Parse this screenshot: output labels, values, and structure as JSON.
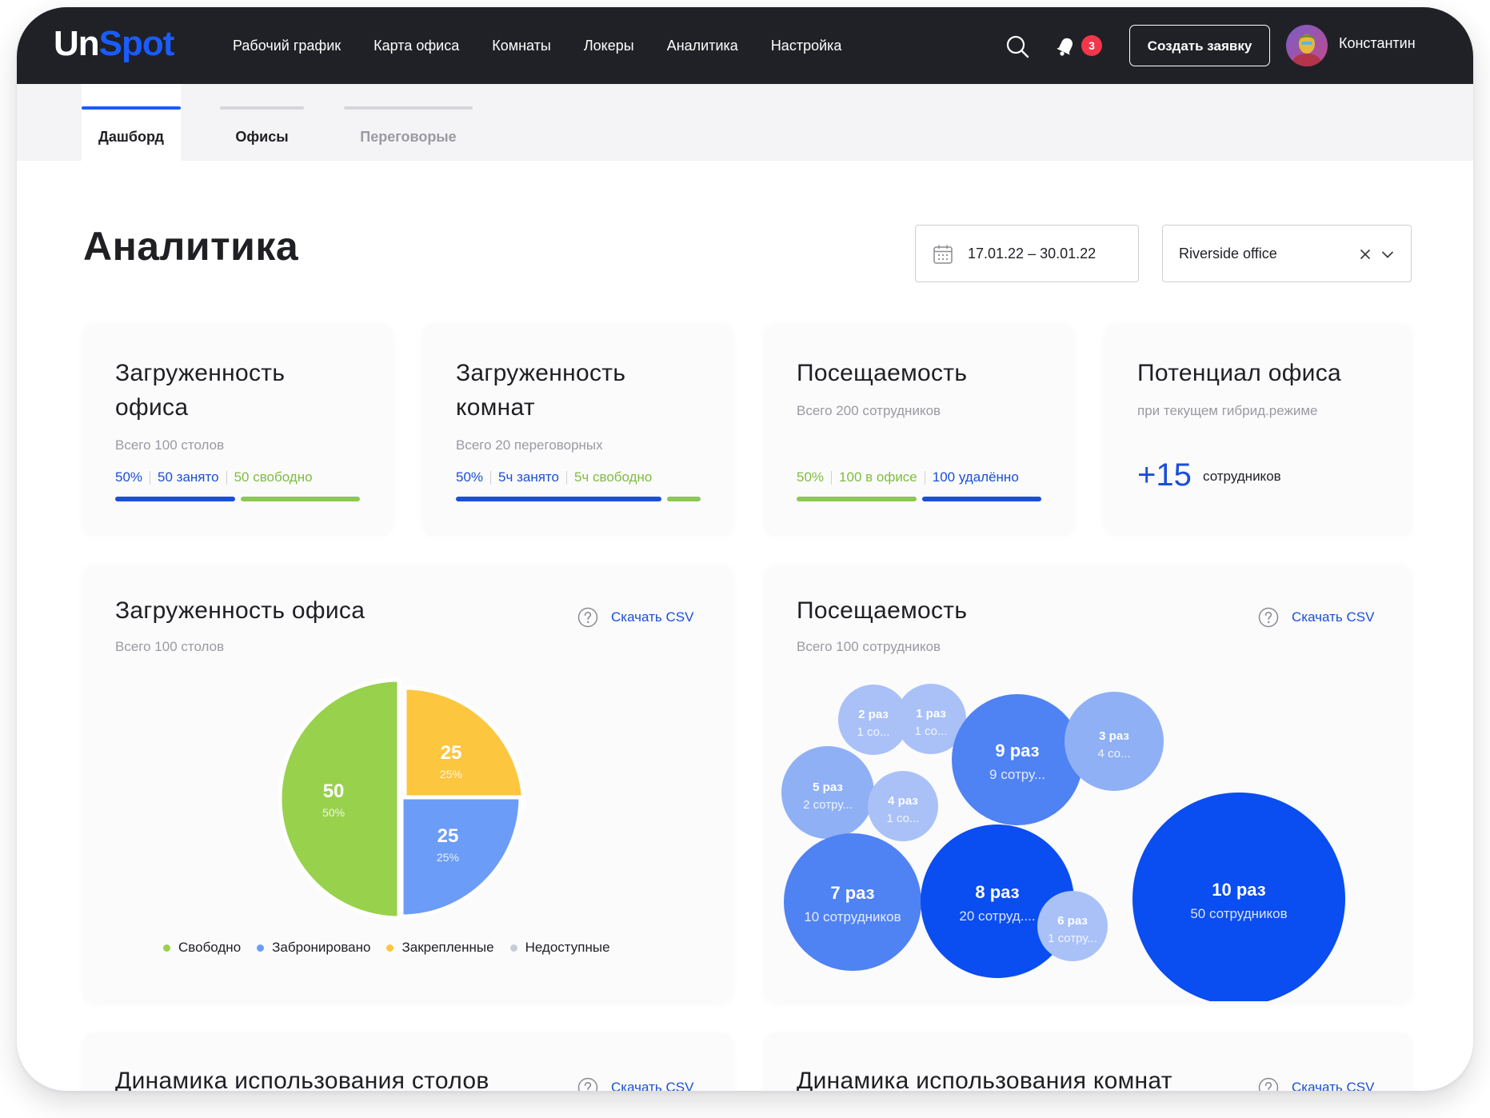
{
  "brand": {
    "logo_part1": "Un",
    "logo_part2": "Spot"
  },
  "nav": {
    "items": [
      "Рабочий график",
      "Карта офиса",
      "Комнаты",
      "Локеры",
      "Аналитика",
      "Настройка"
    ],
    "notifications_count": "3",
    "create_button": "Создать заявку",
    "user_name": "Константин"
  },
  "tabs": [
    {
      "label": "Дашборд",
      "active": true
    },
    {
      "label": "Офисы",
      "active": false
    },
    {
      "label": "Переговорые",
      "active": false
    }
  ],
  "page": {
    "title": "Аналитика",
    "date_range": "17.01.22 – 30.01.22",
    "office": "Riverside office"
  },
  "kpis": {
    "office_load": {
      "title_line1": "Загруженность",
      "title_line2": "офиса",
      "subtitle": "Всего 100 столов",
      "percent": "50%",
      "busy": "50 занято",
      "free": "50 свободно",
      "busy_fraction": 0.5
    },
    "rooms_load": {
      "title_line1": "Загруженность",
      "title_line2": "комнат",
      "subtitle": "Всего 20 переговорных",
      "percent": "50%",
      "busy": "5ч занято",
      "free": "5ч свободно",
      "busy_fraction": 0.86
    },
    "attendance": {
      "title": "Посещаемость",
      "subtitle": "Всего 200 сотрудников",
      "percent": "50%",
      "in_office": "100 в офисе",
      "remote": "100 удалённо",
      "office_fraction": 0.5
    },
    "potential": {
      "title": "Потенциал офиса",
      "subtitle": "при текущем гибрид.режиме",
      "value": "+15",
      "unit": "сотрудников"
    }
  },
  "charts": {
    "office_load": {
      "title": "Загруженность офиса",
      "subtitle": "Всего 100 столов",
      "download": "Скачать CSV"
    },
    "attendance": {
      "title": "Посещаемость",
      "subtitle": "Всего 100 сотрудников",
      "download": "Скачать CSV"
    },
    "desk_dynamics": {
      "title": "Динамика использования столов",
      "download": "Скачать CSV"
    },
    "room_dynamics": {
      "title": "Динамика использования комнат",
      "download": "Скачать CSV"
    }
  },
  "chart_data": [
    {
      "type": "pie",
      "title": "Загруженность офиса",
      "slices": [
        {
          "name": "Свободно",
          "value": 50,
          "value_label": "50",
          "percent_label": "50%",
          "color": "#98d14c"
        },
        {
          "name": "Забронировано",
          "value": 25,
          "value_label": "25",
          "percent_label": "25%",
          "color": "#6b9cf7"
        },
        {
          "name": "Закрепленные",
          "value": 25,
          "value_label": "25",
          "percent_label": "25%",
          "color": "#fdc63f"
        },
        {
          "name": "Недоступные",
          "value": 0,
          "value_label": "",
          "percent_label": "",
          "color": "#c8ccd6"
        }
      ]
    },
    {
      "type": "bubble",
      "title": "Посещаемость",
      "bubbles": [
        {
          "label": "2 раз",
          "sub": "1 со...",
          "times": 2,
          "employees": 1
        },
        {
          "label": "1 раз",
          "sub": "1 со...",
          "times": 1,
          "employees": 1
        },
        {
          "label": "9 раз",
          "sub": "9 сотру...",
          "times": 9,
          "employees": 9
        },
        {
          "label": "3 раз",
          "sub": "4 со...",
          "times": 3,
          "employees": 4
        },
        {
          "label": "5 раз",
          "sub": "2 сотру...",
          "times": 5,
          "employees": 2
        },
        {
          "label": "4 раз",
          "sub": "1 со...",
          "times": 4,
          "employees": 1
        },
        {
          "label": "10 раз",
          "sub": "50 сотрудников",
          "times": 10,
          "employees": 50
        },
        {
          "label": "7 раз",
          "sub": "10 сотрудников",
          "times": 7,
          "employees": 10
        },
        {
          "label": "8 раз",
          "sub": "20 сотруд....",
          "times": 8,
          "employees": 20
        },
        {
          "label": "6 раз",
          "sub": "1 сотру...",
          "times": 6,
          "employees": 1
        }
      ]
    }
  ],
  "colors": {
    "blue": "#1a4fd6",
    "green": "#7dbd3e",
    "bar_blue": "#1a4fd6",
    "bar_green": "#8cc853",
    "pie_free": "#98d14c",
    "pie_booked": "#6b9cf7",
    "pie_fixed": "#fdc63f",
    "pie_unavailable": "#c8ccd6",
    "bubble_light": "#a9c1f7",
    "bubble_mid": "#4f82f3",
    "bubble_dark": "#0a4df0"
  }
}
